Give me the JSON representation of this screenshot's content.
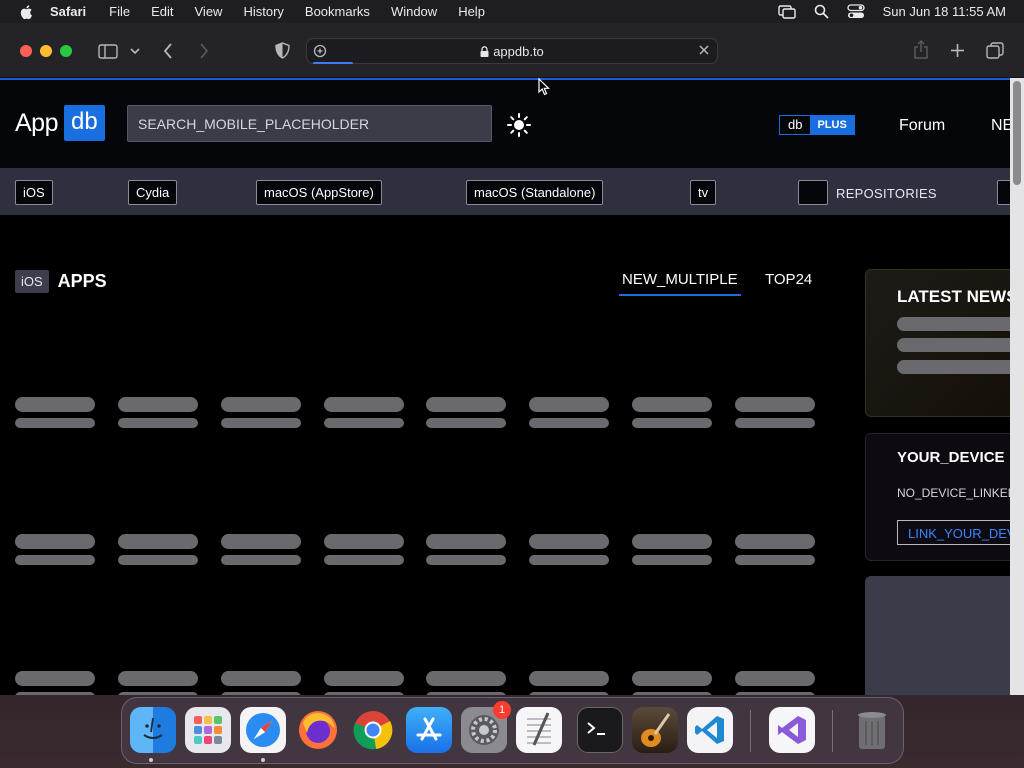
{
  "menubar": {
    "app_name": "Safari",
    "items": [
      "File",
      "Edit",
      "View",
      "History",
      "Bookmarks",
      "Window",
      "Help"
    ],
    "clock": "Sun Jun 18  11:55 AM"
  },
  "browser": {
    "url": "appdb.to",
    "accent": "#3d7cf5"
  },
  "site": {
    "logo_left": "App",
    "logo_right": "db",
    "search_placeholder": "SEARCH_MOBILE_PLACEHOLDER",
    "dbplus_left": "db",
    "dbplus_right": "PLUS",
    "nav": [
      "Forum",
      "NE"
    ],
    "brand_color": "#1a6fe0"
  },
  "categories": [
    "iOS",
    "Cydia",
    "macOS (AppStore)",
    "macOS (Standalone)",
    "tv",
    "REPOSITORIES"
  ],
  "apps_section": {
    "badge": "iOS",
    "title": "APPS",
    "tabs": [
      "NEW_MULTIPLE",
      "TOP24"
    ],
    "active_tab": "NEW_MULTIPLE"
  },
  "sidebar": {
    "news_title": "LATEST NEWS",
    "device_title": "YOUR_DEVICE",
    "device_text": "NO_DEVICE_LINKED",
    "device_button": "LINK_YOUR_DEVICE"
  },
  "dock": {
    "apps": [
      "finder-icon",
      "launchpad-icon",
      "safari-icon",
      "firefox-icon",
      "chrome-icon",
      "app-store-icon",
      "system-settings-icon",
      "textedit-icon",
      "terminal-icon",
      "garageband-icon",
      "vscode-icon",
      "visual-studio-icon",
      "trash-icon"
    ],
    "settings_badge": "1"
  }
}
